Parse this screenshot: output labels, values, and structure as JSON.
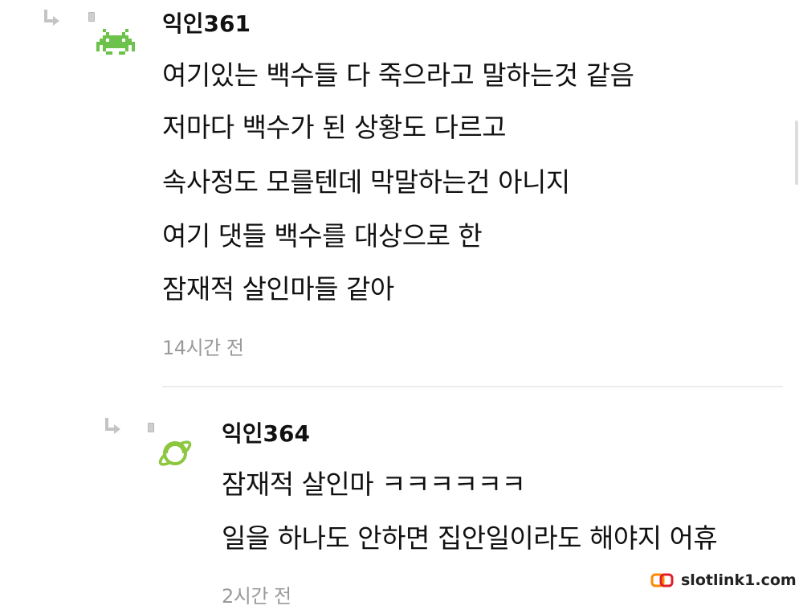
{
  "comments": [
    {
      "nickname": "익인361",
      "avatar_icon": "pixel-invader-icon",
      "avatar_color": "#6cc24a",
      "lines": [
        "여기있는 백수들 다 죽으라고 말하는것 같음",
        "저마다 백수가 된 상황도 다르고",
        "속사정도 모를텐데 막말하는건 아니지",
        "여기 댓들 백수를 대상으로 한",
        "잠재적 살인마들 같아"
      ],
      "time": "14시간 전"
    },
    {
      "nickname": "익인364",
      "avatar_icon": "planet-icon",
      "avatar_color": "#8dc63f",
      "lines": [
        "잠재적 살인마 ㅋㅋㅋㅋㅋㅋ",
        "일을 하나도 안하면 집안일이라도 해야지 어휴"
      ],
      "time": "2시간 전"
    }
  ],
  "watermark": {
    "text": "slotlink1.com",
    "icon": "slotlink-logo-icon",
    "colors": [
      "#ff8a00",
      "#e0202a"
    ]
  }
}
